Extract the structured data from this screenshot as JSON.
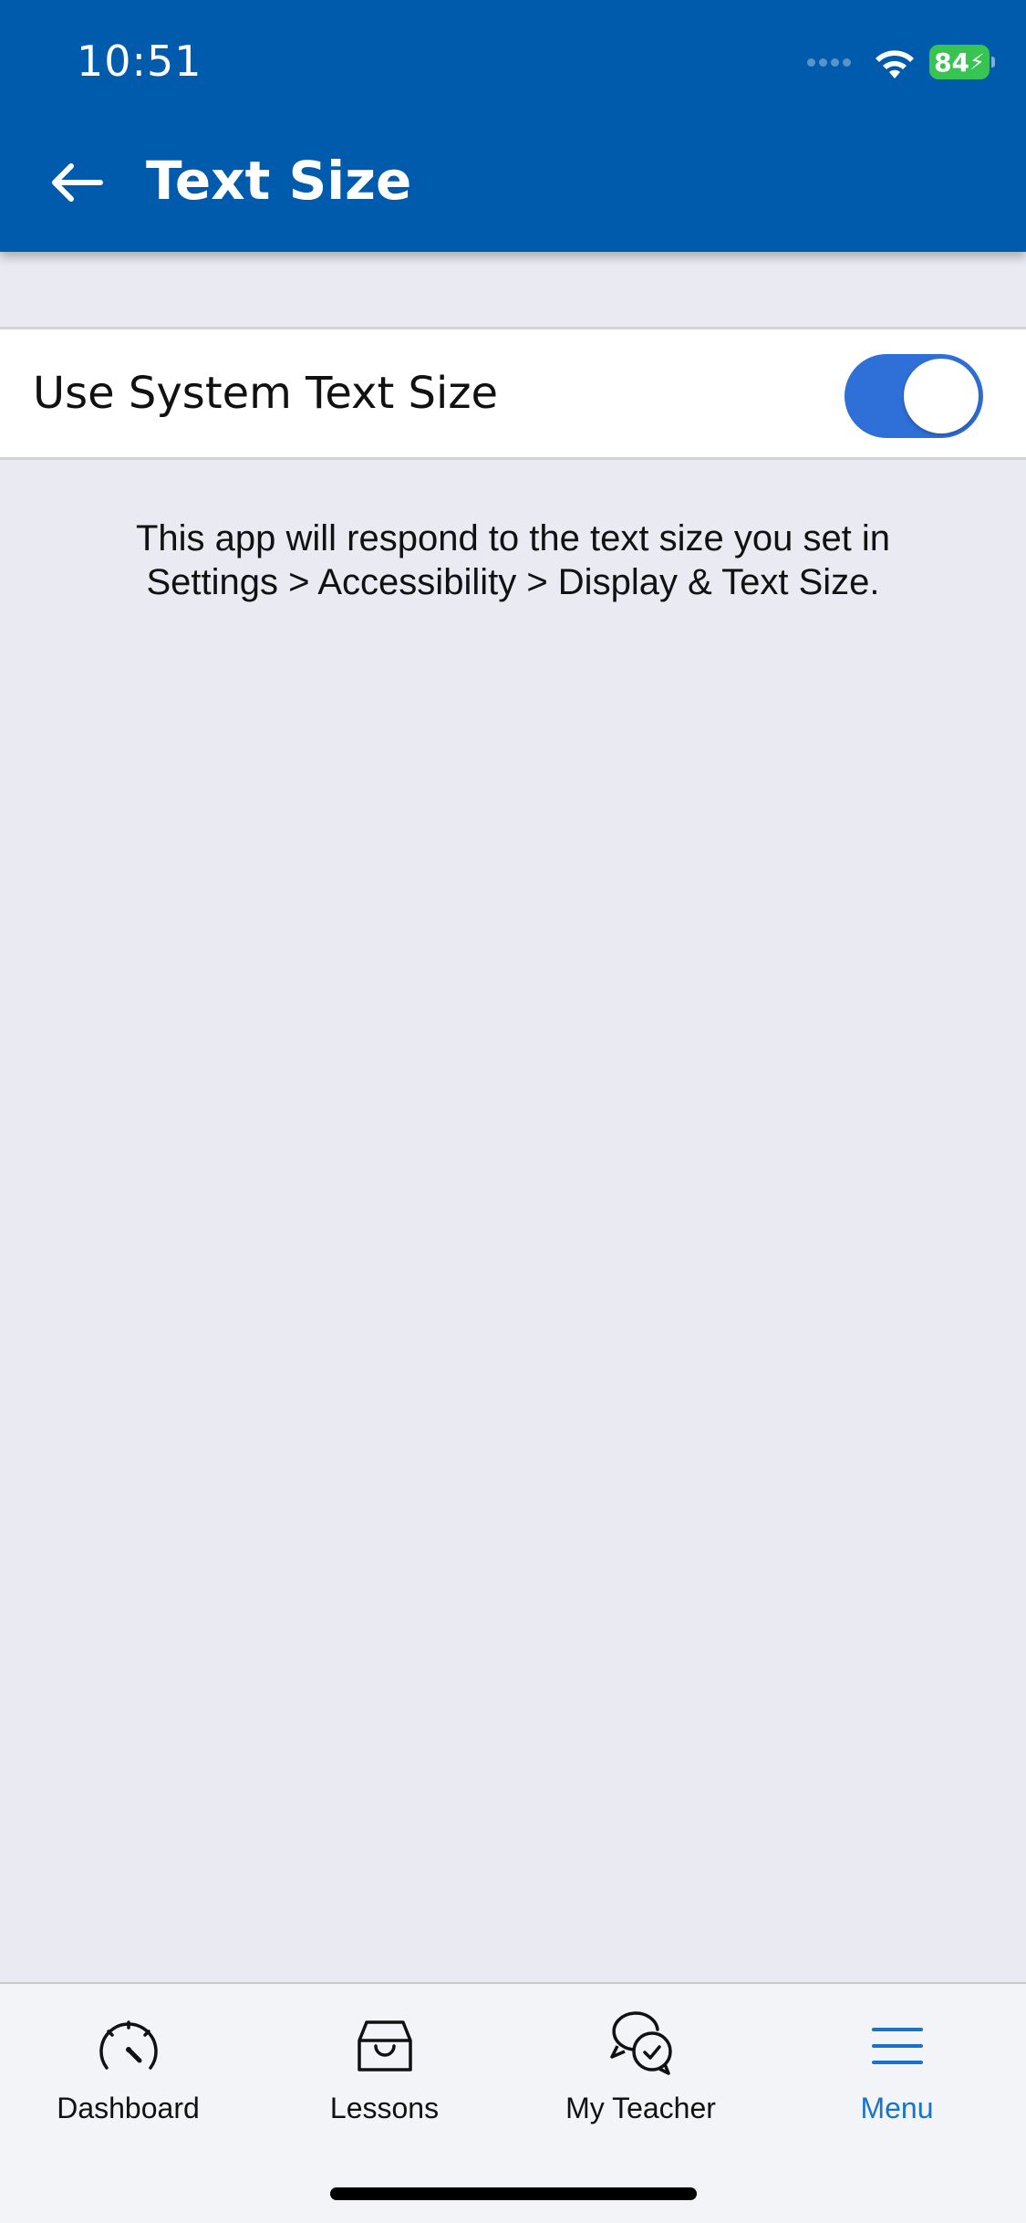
{
  "status_bar": {
    "time": "10:51",
    "battery": "84"
  },
  "header": {
    "title": "Text Size",
    "back_icon": "arrow-left-icon"
  },
  "setting": {
    "label": "Use System Text Size",
    "toggle_on": true,
    "toggle_color": "#2f6fd8"
  },
  "description": {
    "line1": "This app will respond to the text size you set in",
    "line2": "Settings > Accessibility > Display & Text Size."
  },
  "tabs": [
    {
      "label": "Dashboard",
      "icon": "speedometer-icon",
      "active": false
    },
    {
      "label": "Lessons",
      "icon": "inbox-tray-icon",
      "active": false
    },
    {
      "label": "My Teacher",
      "icon": "chat-bubbles-check-icon",
      "active": false
    },
    {
      "label": "Menu",
      "icon": "hamburger-menu-icon",
      "active": true
    }
  ],
  "colors": {
    "header": "#005bac",
    "background": "#e9eaf2",
    "active_tab": "#1a73c6",
    "battery": "#38c452"
  }
}
